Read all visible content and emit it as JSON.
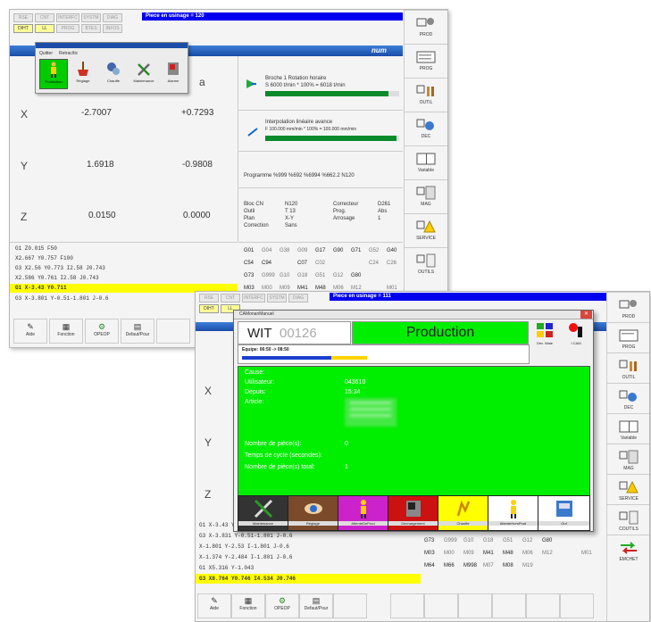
{
  "back": {
    "tabs": [
      "RSE",
      "CNT",
      "INTERFC",
      "SYSTM",
      "DIAG",
      "DIHT",
      "LL",
      "PROG",
      "BTES",
      "INFOS"
    ],
    "title": "Piece en usinage = 120",
    "brand": "num",
    "menu_popup": {
      "menu_items": [
        "Quitter",
        "Retrac/tic"
      ],
      "buttons": [
        "Production",
        "Réglage",
        "Chauffe",
        "Maintenance",
        "Alarme"
      ]
    },
    "axes": [
      {
        "name": "X",
        "v1": "-2.7007",
        "v2": "+0.7293"
      },
      {
        "name": "Y",
        "v1": "1.6918",
        "v2": "-0.9808"
      },
      {
        "name": "Z",
        "v1": "0.0150",
        "v2": "0.0000"
      }
    ],
    "partial_a": "a",
    "spindle": {
      "line1": "Broche 1 Rotation horaire",
      "line2": "S 6000 t/min * 100% = 6018 t/min",
      "fill": 0.92
    },
    "interp": {
      "line1": "Interpolation linéaire avance",
      "line2": "F 100.000 mm/min * 100% = 100.000 mm/min",
      "fill": 0.98
    },
    "program": "Programme %999 %692 %6994 %662.2 N120",
    "bloc": {
      "labels": [
        "Bloc CN",
        "Outil",
        "Plan",
        "Correction"
      ],
      "values": [
        "N120",
        "T 13",
        "X-Y",
        "Sans"
      ],
      "labels2": [
        "Correcteur",
        "Prog.",
        "Arrosage"
      ],
      "values2": [
        "D261",
        "Abs",
        "1"
      ]
    },
    "prog_lines": [
      "G1 Z0.015 F50",
      "X2.667 Y0.757 F100",
      "G3 X2.56 Y0.773 I2.58 J0.743",
      "X2.586 Y0.761 I2.58 J0.743",
      "G1 X-3.43 Y0.711",
      "G3 X-3.801 Y-0.51-1.801 J-0.6"
    ],
    "prog_highlight": 4,
    "gcodes": [
      [
        "G01",
        "G04",
        "G38",
        "G09",
        "G17",
        "G90",
        "G71",
        "G52",
        "G40"
      ],
      [
        "C54",
        "C94",
        "",
        "C07",
        "C02",
        "",
        "",
        "C24",
        "C26"
      ],
      [
        "G73",
        "G999",
        "G10",
        "G18",
        "G51",
        "G12",
        "G80",
        "",
        ""
      ],
      [
        "M03",
        "M00",
        "M09",
        "M41",
        "M48",
        "M06",
        "M12",
        "",
        "M01"
      ]
    ],
    "side_buttons": [
      "PROD",
      "PROG",
      "OUTIL",
      "DEC",
      "Variable",
      "MAG",
      "SERVICE",
      "OUTILS"
    ],
    "fkeys": [
      "Aide",
      "Fonction",
      "OPEOP",
      "Defaut/Pour",
      ""
    ]
  },
  "front": {
    "tabs": [
      "RSE",
      "CNT",
      "INTERFC",
      "SYSTM",
      "DIAG",
      "DIHT",
      "LL"
    ],
    "title": "Piece en usinage = 111",
    "dialog_title": "CAMonanManuel",
    "machine": "WIT00126",
    "machine_prefix": "WIT",
    "machine_suffix": "00126",
    "state": "Production",
    "equipe": "Equipe: 06:50 -> 08:50",
    "icons_right": [
      "Dev. Wale",
      "I CAM"
    ],
    "info_labels": [
      "Cause:",
      "Utilisateur:",
      "Depuis:",
      "Article:"
    ],
    "info_values": [
      "",
      "043610",
      "15:34",
      ""
    ],
    "counts": [
      {
        "label": "Nombre de pièce(s):",
        "value": "0"
      },
      {
        "label": "Temps de cycle (secondes):",
        "value": ""
      },
      {
        "label": "Nombre de pièce(s) total:",
        "value": "1"
      }
    ],
    "bottom_buttons": [
      "Maintenance",
      "Réglage",
      "AttenteDeProd",
      "Déchargement",
      "Chauffe",
      "AttenteHorsProd",
      "Ouf"
    ],
    "axes": [
      "X",
      "Y",
      "Z"
    ],
    "prog_lines": [
      "G1 X-3.43 Y",
      "G3 X-3.831 Y-0.51-1.801 J-0.6",
      "X-1.801 Y-2.53 I-1.801 J-0.6",
      "X-1.374 Y-2.484 I-1.801 J-0.6",
      "G1 X5.316 Y-1.043",
      "G3 X8.764 Y0.746 I4.534 J0.746"
    ],
    "prog_highlight": 5,
    "gcodes": [
      [
        "C54",
        "C94",
        "",
        "C07",
        "C02",
        "",
        "",
        "C24",
        "C25"
      ],
      [
        "G73",
        "G999",
        "G10",
        "G18",
        "G51",
        "G12",
        "G80",
        "",
        ""
      ],
      [
        "M03",
        "M00",
        "M09",
        "M41",
        "M48",
        "M06",
        "M12",
        "",
        "M01"
      ],
      [
        "M64",
        "M66",
        "M998",
        "M07",
        "M08",
        "M19",
        "",
        "",
        ""
      ]
    ],
    "side_buttons": [
      "PROD",
      "PROG",
      "OUTIL",
      "DEC",
      "Variable",
      "MAG",
      "SERVICE",
      "COUTILS",
      "EMCHET"
    ],
    "fkeys": [
      "Aide",
      "Fonction",
      "OPEOP",
      "Defaut/Pour",
      "",
      "",
      "",
      "",
      "",
      "",
      ""
    ],
    "fkeys_right": [
      "",
      "",
      "",
      "",
      "",
      "",
      ""
    ]
  },
  "colors": {
    "green": "#00ee00",
    "blue": "#0000ee",
    "yellow": "#ffff00",
    "bargreen": "#0a8a2a"
  }
}
